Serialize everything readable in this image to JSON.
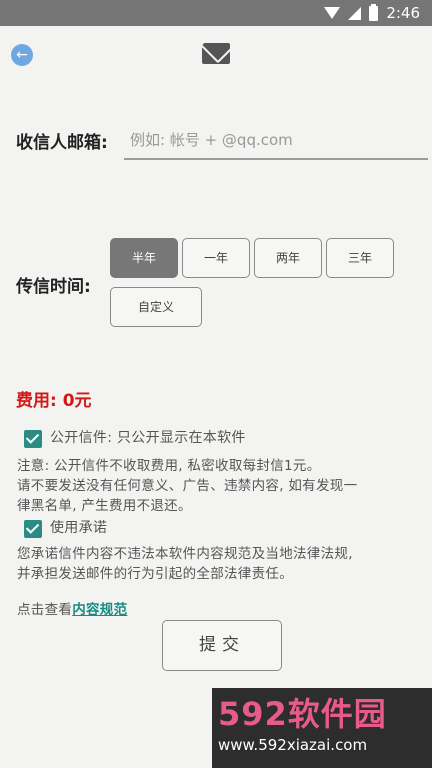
{
  "status_bar": {
    "time": "2:46"
  },
  "header": {
    "icons": [
      "back-arrow-icon",
      "mail-icon"
    ]
  },
  "recipient": {
    "label": "收信人邮箱:",
    "placeholder": "例如: 帐号 + @qq.com",
    "value": ""
  },
  "delivery_time": {
    "label": "传信时间:",
    "options": [
      "半年",
      "一年",
      "两年",
      "三年",
      "自定义"
    ],
    "selected": "半年"
  },
  "fee": {
    "label": "费用: 0元"
  },
  "public_letter": {
    "checked": true,
    "label": "公开信件: 只公开显示在本软件"
  },
  "notice": {
    "line1": "注意: 公开信件不收取费用, 私密收取每封信1元。",
    "line2": "请不要发送没有任何意义、广告、违禁内容, 如有发现一",
    "line3": "律黑名单, 产生费用不退还。"
  },
  "commitment": {
    "checked": true,
    "label": "使用承诺",
    "line1": "您承诺信件内容不违法本软件内容规范及当地法律法规,",
    "line2": "并承担发送邮件的行为引起的全部法律责任。"
  },
  "rules": {
    "prefix": "点击查看",
    "link": "内容规范"
  },
  "submit": {
    "label": "提交"
  },
  "watermark": {
    "title": "592软件园",
    "url": "www.592xiazai.com"
  },
  "colors": {
    "accent": "#2b8c86",
    "fee_red": "#d31818",
    "status_bar": "#757575"
  }
}
